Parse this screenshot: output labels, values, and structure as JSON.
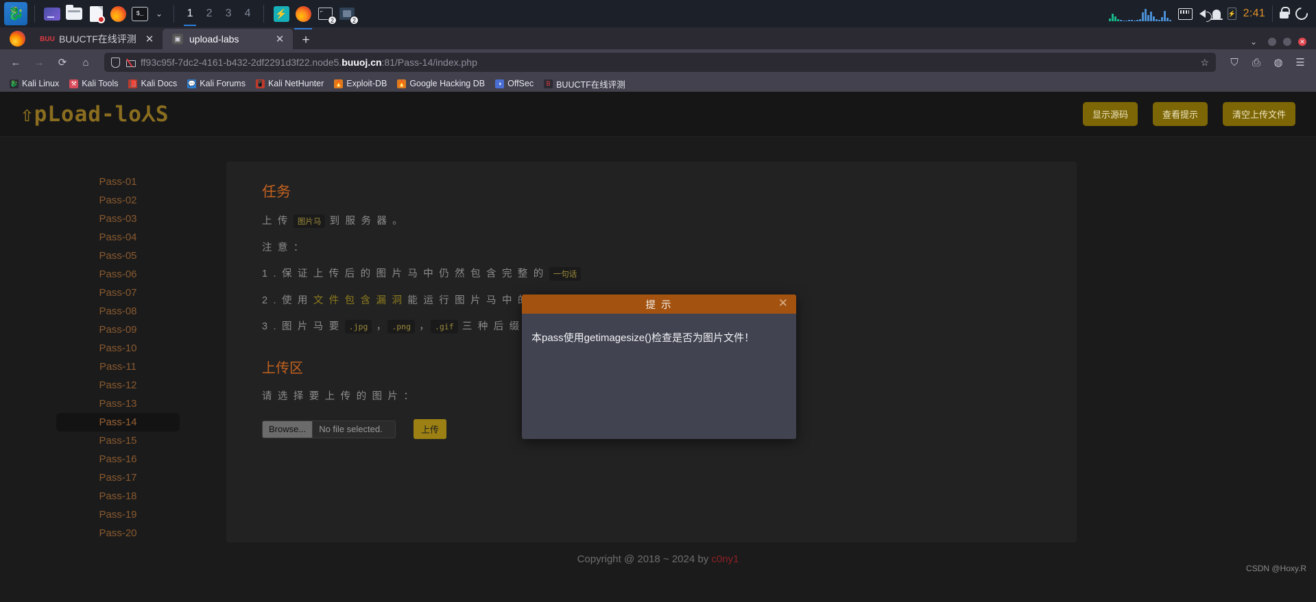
{
  "taskbar": {
    "workspaces": [
      "1",
      "2",
      "3",
      "4"
    ],
    "active_workspace": "1",
    "clock": "2:41",
    "badges": [
      "2",
      "2"
    ],
    "icons": [
      "kali-menu-icon",
      "files-icon",
      "folder-icon",
      "document-icon",
      "firefox-icon",
      "terminal-icon",
      "chevron-down-icon",
      "burp-icon",
      "firefox-running-icon",
      "terminal-window-icon",
      "virtual-machine-icon",
      "network-icon",
      "volume-icon",
      "notification-icon",
      "battery-icon",
      "lock-icon",
      "logout-icon"
    ]
  },
  "browser": {
    "tabs": [
      {
        "label": "BUUCTF在线评测",
        "favicon": "buu",
        "active": false
      },
      {
        "label": "upload-labs",
        "favicon": "ul",
        "active": true
      }
    ],
    "url_prefix": "ff93c95f-7dc2-4161-b432-2df2291d3f22.node5.",
    "url_domain": "buuoj.cn",
    "url_suffix": ":81/Pass-14/index.php",
    "bookmarks": [
      {
        "label": "Kali Linux",
        "color": "#2b2a33"
      },
      {
        "label": "Kali Tools",
        "color": "#d94b5a"
      },
      {
        "label": "Kali Docs",
        "color": "#c0392b"
      },
      {
        "label": "Kali Forums",
        "color": "#2a7fd4"
      },
      {
        "label": "Kali NetHunter",
        "color": "#c0392b"
      },
      {
        "label": "Exploit-DB",
        "color": "#e07b1f"
      },
      {
        "label": "Google Hacking DB",
        "color": "#e07b1f"
      },
      {
        "label": "OffSec",
        "color": "#4a6fd4"
      },
      {
        "label": "BUUCTF在线评测",
        "color": "#e0393e"
      }
    ]
  },
  "site": {
    "logo": "⇧pLoad-lo⅄S",
    "header_buttons": [
      "显示源码",
      "查看提示",
      "清空上传文件"
    ],
    "sidebar": {
      "items": [
        "Pass-01",
        "Pass-02",
        "Pass-03",
        "Pass-04",
        "Pass-05",
        "Pass-06",
        "Pass-07",
        "Pass-08",
        "Pass-09",
        "Pass-10",
        "Pass-11",
        "Pass-12",
        "Pass-13",
        "Pass-14",
        "Pass-15",
        "Pass-16",
        "Pass-17",
        "Pass-18",
        "Pass-19",
        "Pass-20"
      ],
      "active": "Pass-14"
    },
    "task": {
      "title": "任务",
      "line1_a": "上 传 ",
      "line1_code": "图片马",
      "line1_b": " 到 服 务 器 。",
      "notice": "注 意 ：",
      "item1_a": "1 . 保 证 上 传 后 的 图 片 马 中 仍 然 包 含 完 整 的 ",
      "item1_code": "一句话",
      "item2_a": "2 . 使 用 ",
      "item2_hl": "文 件 包 含 漏 洞",
      "item2_b": " 能 运 行 图 片 马 中 的 恶 意 代 码",
      "item3_a": "3 . 图 片 马 要 ",
      "item3_c1": ".jpg",
      "item3_sep1": " ，",
      "item3_c2": ".png",
      "item3_sep2": " ，",
      "item3_c3": ".gif",
      "item3_b": " 三 种 后 缀 都 上 传 成"
    },
    "upload": {
      "title": "上传区",
      "label": "请 选 择 要 上 传 的 图 片 ：",
      "browse_label": "Browse...",
      "file_status": "No file selected.",
      "submit_label": "上传"
    },
    "footer": {
      "text": "Copyright @ 2018 ~ 2024 by ",
      "author": "c0ny1"
    },
    "watermark": "CSDN @Hoxy.R"
  },
  "modal": {
    "title": "提 示",
    "close": "✕",
    "message": "本pass使用getimagesize()检查是否为图片文件！"
  }
}
